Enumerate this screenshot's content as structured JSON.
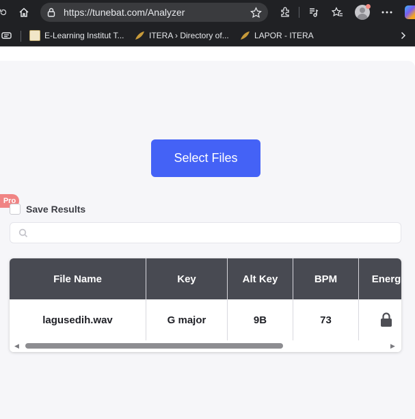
{
  "browser": {
    "url": "https://tunebat.com/Analyzer",
    "bookmarks": [
      {
        "label": "E-Learning Institut T..."
      },
      {
        "label": "ITERA › Directory of..."
      },
      {
        "label": "LAPOR - ITERA"
      }
    ]
  },
  "page": {
    "select_files_label": "Select Files",
    "pro_badge": "Pro",
    "save_results_label": "Save Results",
    "search_placeholder": "",
    "table": {
      "headers": [
        "File Name",
        "Key",
        "Alt Key",
        "BPM",
        "Energ"
      ],
      "rows": [
        {
          "file_name": "lagusedih.wav",
          "key": "G major",
          "alt_key": "9B",
          "bpm": "73"
        }
      ]
    }
  },
  "colors": {
    "accent": "#4462f6",
    "pro": "#f08484",
    "header": "#484a52"
  }
}
